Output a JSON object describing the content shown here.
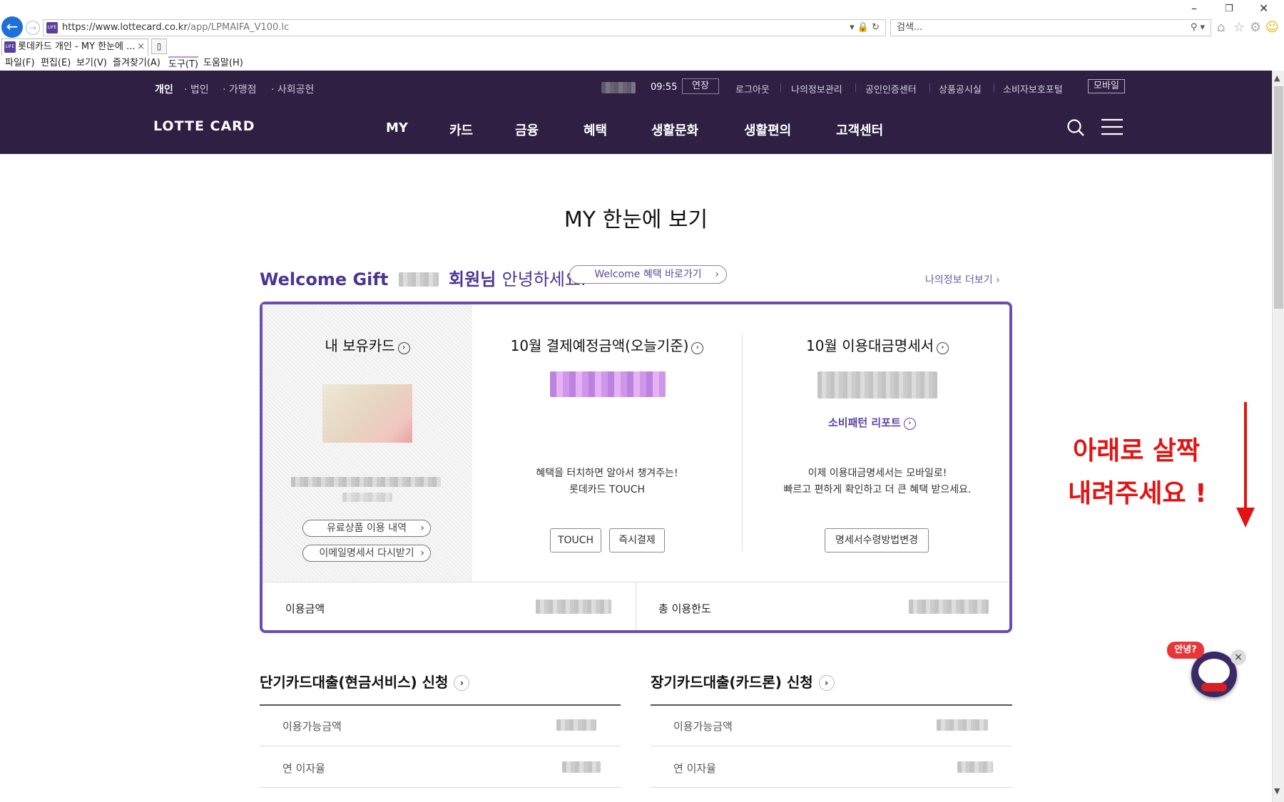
{
  "browser": {
    "url_host": "https://www.lottecard.co.kr",
    "url_path": "/app/LPMAIFA_V100.lc",
    "search_placeholder": "검색...",
    "tab_title": "롯데카드 개인 - MY 한눈에 ...",
    "tab_close": "×",
    "favicon_text": "LIFE",
    "menu": [
      "파일(F)",
      "편집(E)",
      "보기(V)",
      "즐겨찾기(A)",
      "도구(T)",
      "도움말(H)"
    ]
  },
  "header": {
    "top_nav": [
      "개인",
      "법인",
      "가맹점",
      "사회공헌"
    ],
    "session_time": "09:55",
    "extend_label": "연장",
    "utility": [
      "로그아웃",
      "나의정보관리",
      "공인인증센터",
      "상품공시실",
      "소비자보호포털"
    ],
    "mobile_label": "모바일",
    "logo": "LOTTE CARD",
    "gnb": [
      "MY",
      "카드",
      "금융",
      "혜택",
      "생활문화",
      "생활편의",
      "고객센터"
    ]
  },
  "page": {
    "title": "MY 한눈에 보기",
    "welcome_gift": "Welcome Gift",
    "member_suffix": "회원님",
    "greeting": "안녕하세요.",
    "welcome_benefit_btn": "Welcome 혜택 바로가기",
    "my_info_more": "나의정보 더보기"
  },
  "summary": {
    "my_cards_title": "내 보유카드",
    "paid_usage_btn": "유료상품 이용 내역",
    "email_statement_btn": "이메일명세서 다시받기",
    "payment_title": "10월 결제예정금액(오늘기준)",
    "touch_desc_1": "혜택을 터치하면 알아서 챙겨주는!",
    "touch_desc_2": "롯데카드 TOUCH",
    "touch_btn": "TOUCH",
    "instant_pay_btn": "즉시결제",
    "statement_title": "10월 이용대금명세서",
    "spending_report": "소비패턴 리포트",
    "statement_desc_1": "이제 이용대금명세서는 모바일로!",
    "statement_desc_2": "빠르고 편하게 확인하고 더 큰 혜택 받으세요.",
    "change_receipt_btn": "명세서수령방법변경",
    "usage_amount_label": "이용금액",
    "total_limit_label": "총 이용한도"
  },
  "loans": {
    "short_title": "단기카드대출(현금서비스) 신청",
    "long_title": "장기카드대출(카드론) 신청",
    "available_label": "이용가능금액",
    "rate_label": "연 이자율"
  },
  "annotation": {
    "line1": "아래로 살짝",
    "line2": "내려주세요 !"
  },
  "chatbot": {
    "bubble": "안녕?",
    "close": "×"
  },
  "colors": {
    "header_bg": "#2e1f43",
    "accent_purple": "#6b4db5",
    "annotation_red": "#e41313"
  }
}
